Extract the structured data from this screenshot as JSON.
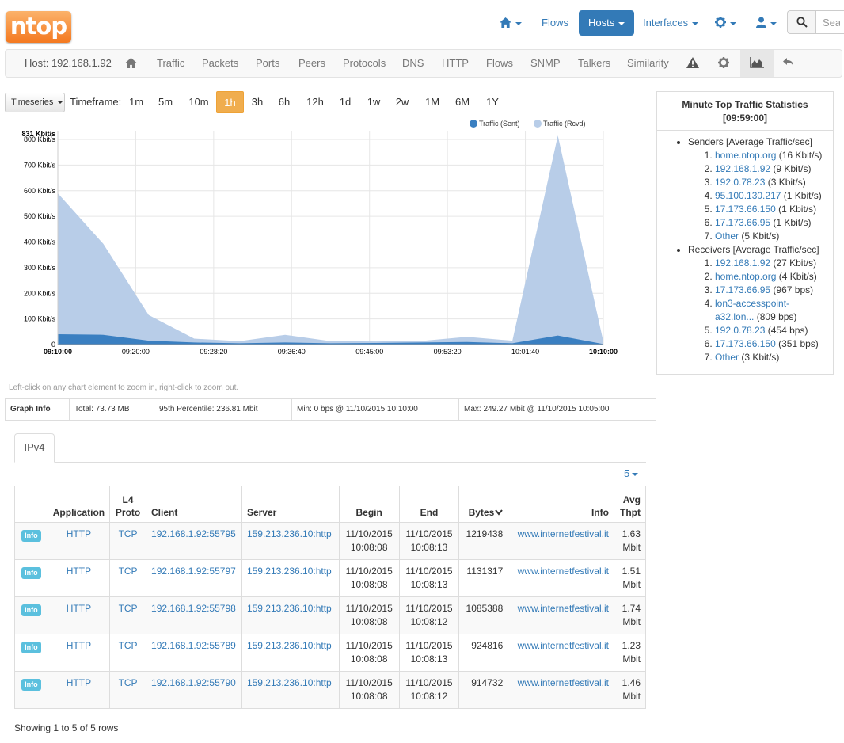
{
  "brand": {
    "logo": "ntop"
  },
  "topnav": {
    "home_icon": "home-icon",
    "flows": "Flows",
    "hosts": "Hosts",
    "interfaces": "Interfaces",
    "settings_icon": "gear-icon",
    "user_icon": "user-icon",
    "search_placeholder": "Search"
  },
  "hostbar": {
    "host_label": "Host: 192.168.1.92",
    "items": [
      "Traffic",
      "Packets",
      "Ports",
      "Peers",
      "Protocols",
      "DNS",
      "HTTP",
      "Flows",
      "SNMP",
      "Talkers",
      "Similarity"
    ],
    "icons": [
      "home-icon",
      "warning-icon",
      "gear-icon",
      "area-chart-icon",
      "undo-icon"
    ]
  },
  "timeframe": {
    "dropdown_label": "Timeseries",
    "label": "Timeframe:",
    "options": [
      "1m",
      "5m",
      "10m",
      "1h",
      "3h",
      "6h",
      "12h",
      "1d",
      "1w",
      "2w",
      "1M",
      "6M",
      "1Y"
    ],
    "selected": "1h"
  },
  "chart_data": {
    "type": "area",
    "stacked": true,
    "x": [
      "09:10:00",
      "09:15:00",
      "09:20:00",
      "09:25:00",
      "09:30:00",
      "09:35:00",
      "09:40:00",
      "09:45:00",
      "09:50:00",
      "09:55:00",
      "10:00:00",
      "10:05:00",
      "10:10:00"
    ],
    "xticks": [
      "09:10:00",
      "09:20:00",
      "09:28:20",
      "09:36:40",
      "09:45:00",
      "09:53:20",
      "10:01:40",
      "10:10:00"
    ],
    "yticks": [
      "0",
      "100 Kbit/s",
      "200 Kbit/s",
      "300 Kbit/s",
      "400 Kbit/s",
      "500 Kbit/s",
      "600 Kbit/s",
      "700 Kbit/s",
      "800 Kbit/s"
    ],
    "ymax_label": "831 Kbit/s",
    "ylim": [
      0,
      831
    ],
    "series": [
      {
        "name": "Traffic (Sent)",
        "color": "#3a7fc1",
        "values": [
          40,
          38,
          15,
          8,
          5,
          8,
          5,
          6,
          8,
          10,
          5,
          35,
          2
        ]
      },
      {
        "name": "Traffic (Rcvd)",
        "color": "#b8cde8",
        "values": [
          550,
          355,
          100,
          15,
          8,
          30,
          8,
          6,
          6,
          20,
          10,
          780,
          10
        ]
      }
    ],
    "legend_position": "top-right",
    "grid": true
  },
  "chart_hint": "Left-click on any chart element to zoom in, right-click to zoom out.",
  "graph_info": {
    "label": "Graph Info",
    "total": "Total: 73.73 MB",
    "percentile": "95th Percentile: 236.81 Mbit",
    "min": "Min: 0 bps @ 11/10/2015 10:10:00",
    "max": "Max: 249.27 Mbit @ 11/10/2015 10:05:00"
  },
  "top_stats": {
    "title": "Minute Top Traffic Statistics",
    "time": "[09:59:00]",
    "senders_label": "Senders [Average Traffic/sec]",
    "senders": [
      {
        "host": "home.ntop.org",
        "rate": "(16 Kbit/s)"
      },
      {
        "host": "192.168.1.92",
        "rate": "(9 Kbit/s)"
      },
      {
        "host": "192.0.78.23",
        "rate": "(3 Kbit/s)"
      },
      {
        "host": "95.100.130.217",
        "rate": "(1 Kbit/s)"
      },
      {
        "host": "17.173.66.150",
        "rate": "(1 Kbit/s)"
      },
      {
        "host": "17.173.66.95",
        "rate": "(1 Kbit/s)"
      },
      {
        "host": "Other",
        "rate": "(5 Kbit/s)"
      }
    ],
    "receivers_label": "Receivers [Average Traffic/sec]",
    "receivers": [
      {
        "host": "192.168.1.92",
        "rate": "(27 Kbit/s)"
      },
      {
        "host": "home.ntop.org",
        "rate": "(4 Kbit/s)"
      },
      {
        "host": "17.173.66.95",
        "rate": "(967 bps)"
      },
      {
        "host": "lon3-accesspoint-a32.lon...",
        "rate": "(809 bps)"
      },
      {
        "host": "192.0.78.23",
        "rate": "(454 bps)"
      },
      {
        "host": "17.173.66.150",
        "rate": "(351 bps)"
      },
      {
        "host": "Other",
        "rate": "(3 Kbit/s)"
      }
    ]
  },
  "tabs": {
    "ipv4": "IPv4"
  },
  "table": {
    "page_size": "5",
    "headers": {
      "application": "Application",
      "l4proto": "L4 Proto",
      "client": "Client",
      "server": "Server",
      "begin": "Begin",
      "end": "End",
      "bytes": "Bytes",
      "info": "Info",
      "avg": "Avg Thpt"
    },
    "rows": [
      {
        "label": "Info",
        "app": "HTTP",
        "proto": "TCP",
        "client": "192.168.1.92:55795",
        "server": "159.213.236.10:http",
        "begin_date": "11/10/2015",
        "begin_time": "10:08:08",
        "end_date": "11/10/2015",
        "end_time": "10:08:13",
        "bytes": "1219438",
        "info": "www.internetfestival.it",
        "thpt_val": "1.63",
        "thpt_unit": "Mbit"
      },
      {
        "label": "Info",
        "app": "HTTP",
        "proto": "TCP",
        "client": "192.168.1.92:55797",
        "server": "159.213.236.10:http",
        "begin_date": "11/10/2015",
        "begin_time": "10:08:08",
        "end_date": "11/10/2015",
        "end_time": "10:08:13",
        "bytes": "1131317",
        "info": "www.internetfestival.it",
        "thpt_val": "1.51",
        "thpt_unit": "Mbit"
      },
      {
        "label": "Info",
        "app": "HTTP",
        "proto": "TCP",
        "client": "192.168.1.92:55798",
        "server": "159.213.236.10:http",
        "begin_date": "11/10/2015",
        "begin_time": "10:08:08",
        "end_date": "11/10/2015",
        "end_time": "10:08:12",
        "bytes": "1085388",
        "info": "www.internetfestival.it",
        "thpt_val": "1.74",
        "thpt_unit": "Mbit"
      },
      {
        "label": "Info",
        "app": "HTTP",
        "proto": "TCP",
        "client": "192.168.1.92:55789",
        "server": "159.213.236.10:http",
        "begin_date": "11/10/2015",
        "begin_time": "10:08:08",
        "end_date": "11/10/2015",
        "end_time": "10:08:13",
        "bytes": "924816",
        "info": "www.internetfestival.it",
        "thpt_val": "1.23",
        "thpt_unit": "Mbit"
      },
      {
        "label": "Info",
        "app": "HTTP",
        "proto": "TCP",
        "client": "192.168.1.92:55790",
        "server": "159.213.236.10:http",
        "begin_date": "11/10/2015",
        "begin_time": "10:08:08",
        "end_date": "11/10/2015",
        "end_time": "10:08:12",
        "bytes": "914732",
        "info": "www.internetfestival.it",
        "thpt_val": "1.46",
        "thpt_unit": "Mbit"
      }
    ],
    "footer": "Showing 1 to 5 of 5 rows"
  }
}
